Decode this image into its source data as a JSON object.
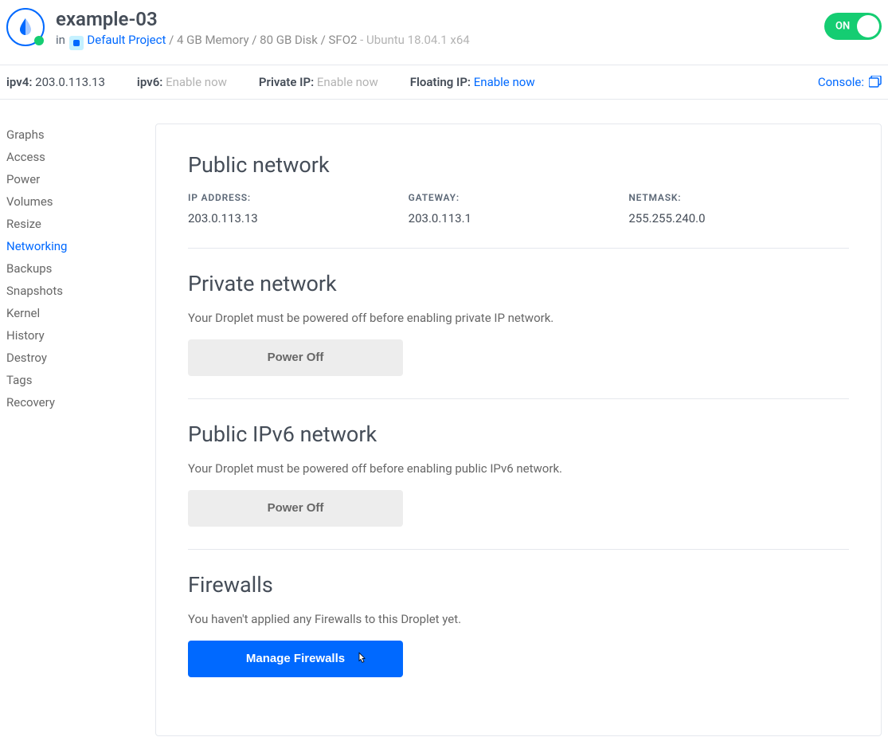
{
  "header": {
    "title": "example-03",
    "in_label": "in",
    "project": "Default Project",
    "specs_sep1": " / ",
    "specs": "4 GB Memory / 80 GB Disk / SFO2",
    "os_sep": " - ",
    "os": "Ubuntu 18.04.1 x64",
    "toggle": "ON"
  },
  "info_bar": {
    "ipv4_label": "ipv4:",
    "ipv4_value": "203.0.113.13",
    "ipv6_label": "ipv6:",
    "ipv6_value": "Enable now",
    "private_ip_label": "Private IP:",
    "private_ip_value": "Enable now",
    "floating_ip_label": "Floating IP:",
    "floating_ip_value": "Enable now",
    "console_label": "Console:"
  },
  "sidebar": {
    "items": [
      {
        "label": "Graphs",
        "active": false
      },
      {
        "label": "Access",
        "active": false
      },
      {
        "label": "Power",
        "active": false
      },
      {
        "label": "Volumes",
        "active": false
      },
      {
        "label": "Resize",
        "active": false
      },
      {
        "label": "Networking",
        "active": true
      },
      {
        "label": "Backups",
        "active": false
      },
      {
        "label": "Snapshots",
        "active": false
      },
      {
        "label": "Kernel",
        "active": false
      },
      {
        "label": "History",
        "active": false
      },
      {
        "label": "Destroy",
        "active": false
      },
      {
        "label": "Tags",
        "active": false
      },
      {
        "label": "Recovery",
        "active": false
      }
    ]
  },
  "sections": {
    "public": {
      "heading": "Public network",
      "ip_label": "IP ADDRESS:",
      "ip_value": "203.0.113.13",
      "gateway_label": "GATEWAY:",
      "gateway_value": "203.0.113.1",
      "netmask_label": "NETMASK:",
      "netmask_value": "255.255.240.0"
    },
    "private": {
      "heading": "Private network",
      "desc": "Your Droplet must be powered off before enabling private IP network.",
      "button": "Power Off"
    },
    "ipv6": {
      "heading": "Public IPv6 network",
      "desc": "Your Droplet must be powered off before enabling public IPv6 network.",
      "button": "Power Off"
    },
    "firewalls": {
      "heading": "Firewalls",
      "desc": "You haven't applied any Firewalls to this Droplet yet.",
      "button": "Manage Firewalls"
    }
  }
}
